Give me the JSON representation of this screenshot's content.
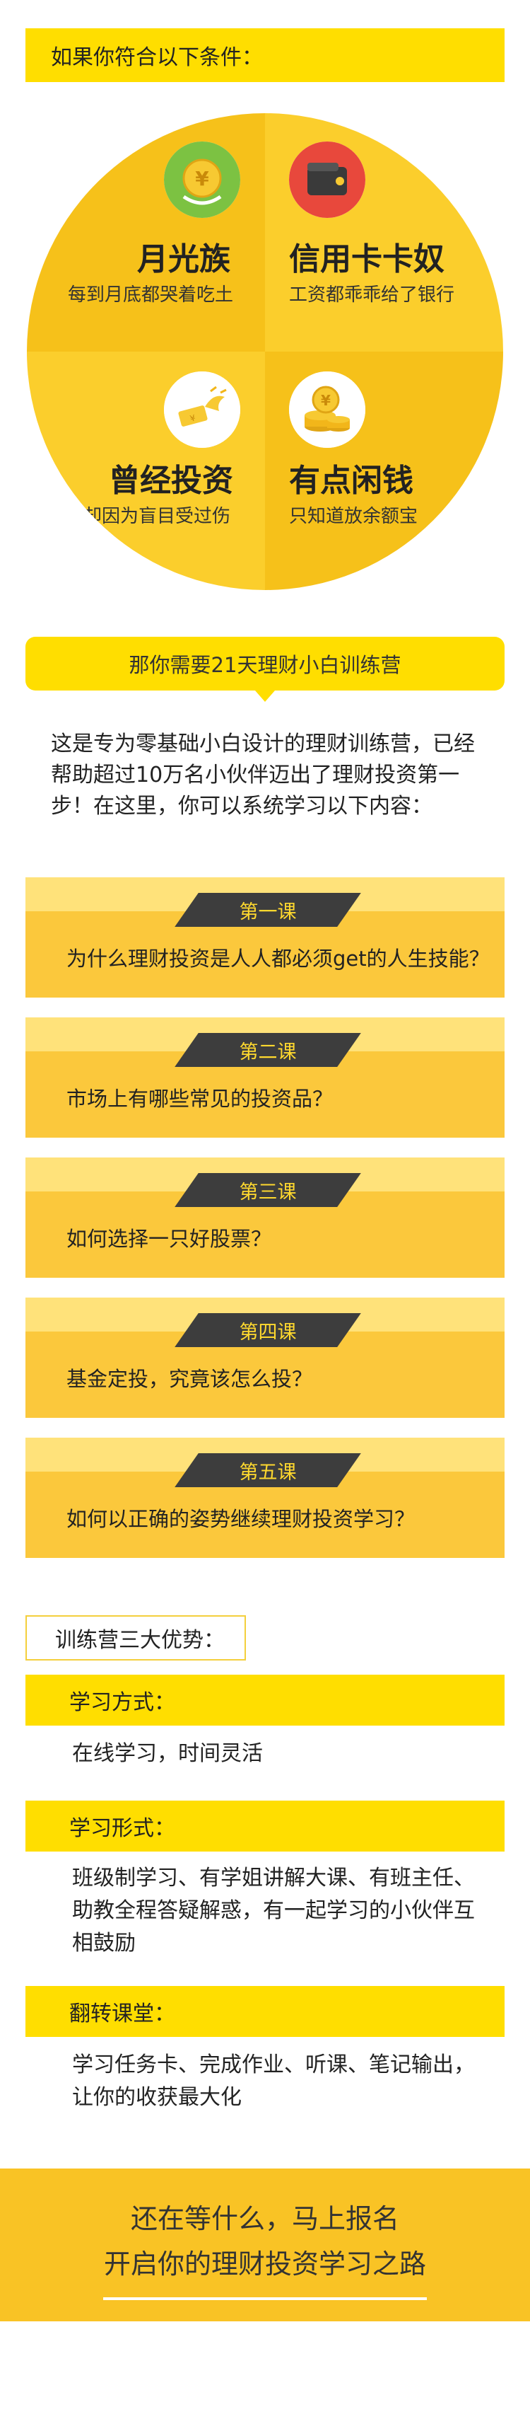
{
  "conditions": {
    "title": "如果你符合以下条件：",
    "items": [
      {
        "title": "月光族",
        "subtitle": "每到月底都哭着吃土",
        "icon": "coin-yen-icon"
      },
      {
        "title": "信用卡卡奴",
        "subtitle": "工资都乖乖给了银行",
        "icon": "wallet-icon"
      },
      {
        "title": "曾经投资",
        "subtitle": "却因为盲目受过伤",
        "icon": "flying-money-icon"
      },
      {
        "title": "有点闲钱",
        "subtitle": "只知道放余额宝",
        "icon": "coin-stack-icon"
      }
    ]
  },
  "camp": {
    "banner": "那你需要21天理财小白训练营",
    "intro": "这是专为零基础小白设计的理财训练营，已经帮助超过10万名小伙伴迈出了理财投资第一步！在这里，你可以系统学习以下内容："
  },
  "lessons": [
    {
      "tag": "第一课",
      "question": "为什么理财投资是人人都必须get的人生技能？"
    },
    {
      "tag": "第二课",
      "question": "市场上有哪些常见的投资品？"
    },
    {
      "tag": "第三课",
      "question": "如何选择一只好股票？"
    },
    {
      "tag": "第四课",
      "question": "基金定投，究竟该怎么投？"
    },
    {
      "tag": "第五课",
      "question": "如何以正确的姿势继续理财投资学习？"
    }
  ],
  "advantages": {
    "label": "训练营三大优势：",
    "items": [
      {
        "title": "学习方式：",
        "text": "在线学习，时间灵活"
      },
      {
        "title": "学习形式：",
        "text": "班级制学习、有学姐讲解大课、有班主任、助教全程答疑解惑，有一起学习的小伙伴互相鼓励"
      },
      {
        "title": "翻转课堂：",
        "text": "学习任务卡、完成作业、听课、笔记输出，让你的收获最大化"
      }
    ]
  },
  "cta": {
    "line1": "还在等什么，马上报名",
    "line2": "开启你的理财投资学习之路"
  },
  "colors": {
    "accent": "#ffde00",
    "circle_dark": "#f6c11a",
    "circle_light": "#fbce2c",
    "lesson_body": "#fbc83c",
    "lesson_band": "#ffe27a",
    "tag_bg": "#3d3d3d",
    "cta_bg": "#f9c325"
  }
}
